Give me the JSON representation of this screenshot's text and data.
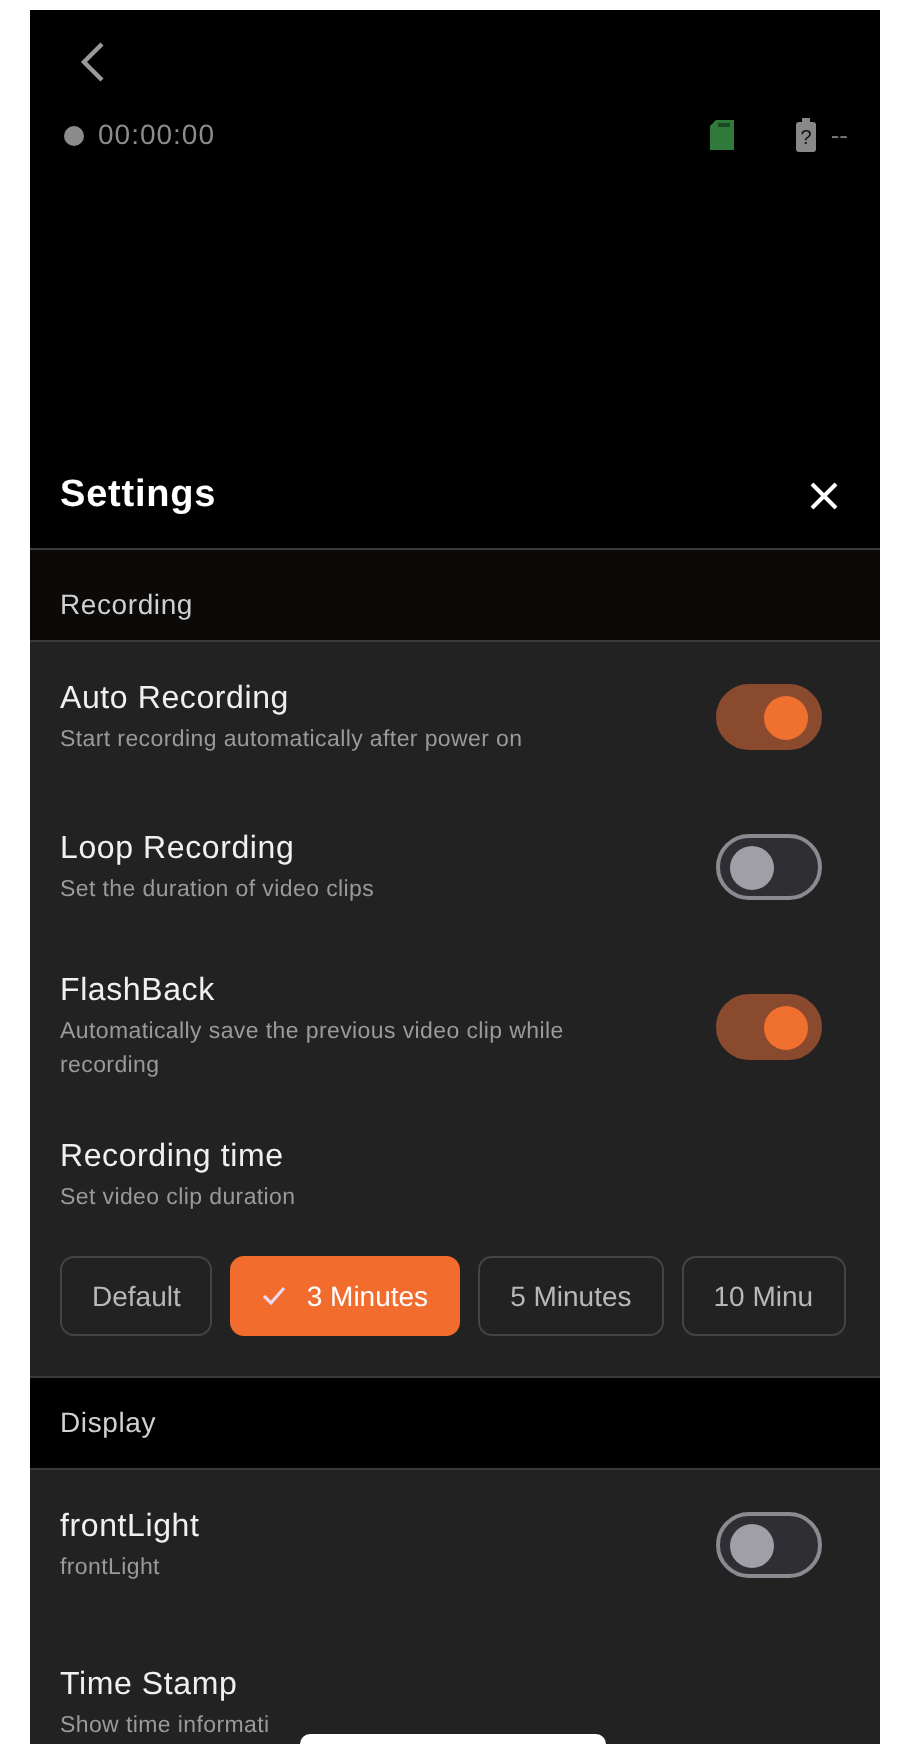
{
  "status": {
    "timer": "00:00:00",
    "battery_mark": "?",
    "battery_reading": "--"
  },
  "settings": {
    "title": "Settings",
    "sections": [
      {
        "title": "Recording",
        "items": [
          {
            "kind": "toggle",
            "title": "Auto Recording",
            "subtitle": "Start recording automatically after power on",
            "on": true
          },
          {
            "kind": "toggle",
            "title": "Loop Recording",
            "subtitle": "Set the duration of video clips",
            "on": false
          },
          {
            "kind": "toggle",
            "title": "FlashBack",
            "subtitle": "Automatically save the previous video clip while recording",
            "on": true
          },
          {
            "kind": "choice",
            "title": "Recording time",
            "subtitle": "Set video clip duration",
            "options": [
              {
                "label": "Default",
                "selected": false
              },
              {
                "label": "3 Minutes",
                "selected": true
              },
              {
                "label": "5 Minutes",
                "selected": false
              },
              {
                "label": "10 Minu",
                "selected": false
              }
            ]
          }
        ]
      },
      {
        "title": "Display",
        "items": [
          {
            "kind": "toggle",
            "title": "frontLight",
            "subtitle": "frontLight",
            "on": false
          },
          {
            "kind": "info",
            "title": "Time Stamp",
            "subtitle": "Show time informati"
          }
        ]
      }
    ]
  }
}
